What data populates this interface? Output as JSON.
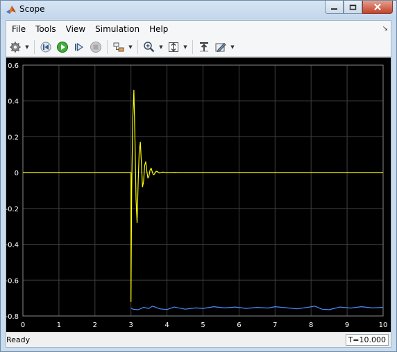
{
  "window": {
    "title": "Scope"
  },
  "menu": {
    "items": [
      "File",
      "Tools",
      "View",
      "Simulation",
      "Help"
    ]
  },
  "toolbar": {
    "icons": [
      "gear-icon",
      "step-back-icon",
      "run-icon",
      "step-forward-icon",
      "stop-icon",
      "highlight-block-icon",
      "zoom-icon",
      "scale-y-icon",
      "restore-view-icon",
      "style-icon"
    ]
  },
  "status": {
    "text": "Ready",
    "time": "T=10.000"
  },
  "colors": {
    "plot_bg": "#000000",
    "grid": "#404040",
    "axis_text": "#ffffff",
    "series1": "#ffff00",
    "series2": "#4d8cff"
  },
  "chart_data": {
    "type": "line",
    "xlim": [
      0,
      10
    ],
    "ylim": [
      -0.8,
      0.6
    ],
    "xticks": [
      "0",
      "1",
      "2",
      "3",
      "4",
      "5",
      "6",
      "7",
      "8",
      "9",
      "10"
    ],
    "yticks": [
      "0.6",
      "0.4",
      "0.2",
      "0",
      "-0.2",
      "-0.4",
      "-0.6",
      "-0.8"
    ],
    "grid": true,
    "series": [
      {
        "color": "#ffff00",
        "x": [
          0,
          3.0,
          3.0,
          3.02,
          3.05,
          3.08,
          3.11,
          3.14,
          3.17,
          3.2,
          3.23,
          3.26,
          3.29,
          3.32,
          3.35,
          3.38,
          3.41,
          3.44,
          3.47,
          3.5,
          3.53,
          3.56,
          3.59,
          3.62,
          3.65,
          3.7,
          3.75,
          3.8,
          3.85,
          3.9,
          3.95,
          4.0,
          4.1,
          4.2,
          4.35,
          10
        ],
        "y": [
          0,
          0,
          -0.72,
          -0.1,
          0.3,
          0.46,
          0.2,
          -0.15,
          -0.28,
          -0.05,
          0.12,
          0.17,
          0.05,
          -0.08,
          -0.05,
          0.04,
          0.06,
          0.01,
          -0.03,
          -0.02,
          0.015,
          0.025,
          0.005,
          -0.012,
          -0.008,
          0.008,
          0.004,
          -0.003,
          0.002,
          0.003,
          0.0,
          0.001,
          -0.001,
          0.001,
          0.0,
          0
        ]
      },
      {
        "color": "#4d8cff",
        "x": [
          3.0,
          3.05,
          3.2,
          3.35,
          3.5,
          3.6,
          3.8,
          4.0,
          4.2,
          4.5,
          4.8,
          5.0,
          5.3,
          5.6,
          5.9,
          6.2,
          6.5,
          6.8,
          7.0,
          7.3,
          7.6,
          7.9,
          8.1,
          8.3,
          8.5,
          8.8,
          9.1,
          9.4,
          9.7,
          10
        ],
        "y": [
          -0.755,
          -0.762,
          -0.765,
          -0.752,
          -0.758,
          -0.745,
          -0.76,
          -0.764,
          -0.75,
          -0.762,
          -0.755,
          -0.758,
          -0.748,
          -0.755,
          -0.75,
          -0.758,
          -0.752,
          -0.756,
          -0.748,
          -0.754,
          -0.76,
          -0.752,
          -0.745,
          -0.762,
          -0.765,
          -0.75,
          -0.756,
          -0.748,
          -0.755,
          -0.752
        ]
      }
    ]
  }
}
